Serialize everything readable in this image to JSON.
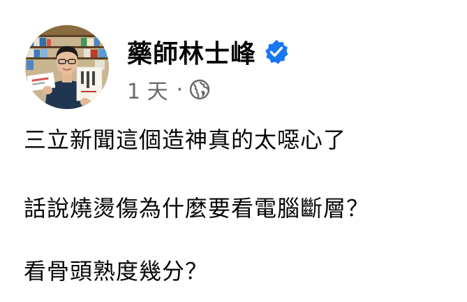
{
  "post": {
    "author": {
      "name": "藥師林士峰",
      "verified_icon": "verified-badge-icon",
      "verified_color": "#1877f2"
    },
    "meta": {
      "timestamp": "1 天",
      "separator": "·",
      "audience_icon": "globe-icon"
    },
    "body": {
      "lines": [
        "三立新聞這個造神真的太噁心了",
        "話說燒燙傷為什麼要看電腦斷層？",
        "看骨頭熟度幾分？"
      ]
    }
  },
  "colors": {
    "text_primary": "#050505",
    "text_secondary": "#65676b",
    "accent": "#1877f2",
    "background": "#ffffff"
  }
}
